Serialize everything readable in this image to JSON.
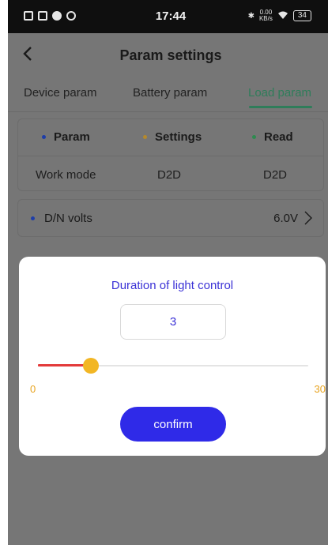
{
  "status_bar": {
    "time": "17:44",
    "speed_value": "0.00",
    "speed_unit": "KB/s",
    "battery": "34",
    "left_icons": [
      "notification-icon",
      "message-icon",
      "app-icon",
      "sync-icon"
    ],
    "right_icons": [
      "bluetooth-icon",
      "wifi-icon",
      "battery-icon"
    ]
  },
  "header": {
    "back_icon": "chevron-left-icon",
    "title": "Param settings"
  },
  "tabs": [
    {
      "label": "Device param",
      "active": false
    },
    {
      "label": "Battery param",
      "active": false
    },
    {
      "label": "Load param",
      "active": true
    }
  ],
  "param_table": {
    "headers": [
      {
        "label": "Param",
        "dot_color": "#1e3da8"
      },
      {
        "label": "Settings",
        "dot_color": "#b5892c"
      },
      {
        "label": "Read",
        "dot_color": "#2e8a4f"
      }
    ],
    "rows": [
      {
        "param": "Work mode",
        "settings": "D2D",
        "read": "D2D"
      }
    ]
  },
  "dn_volts": {
    "label": "D/N volts",
    "value": "6.0V",
    "dot_color": "#1e3da8"
  },
  "dialog": {
    "title": "Duration of light control",
    "input_value": "3",
    "slider": {
      "min": "0",
      "max": "30",
      "value": 3
    },
    "confirm_label": "confirm"
  },
  "colors": {
    "accent_tab": "#2f7d5a",
    "dialog_title": "#3b32d6",
    "confirm_button": "#2f2ae8",
    "slider_thumb": "#f2b624",
    "slider_fill": "#e33b3b",
    "slider_labels": "#e8a420"
  }
}
